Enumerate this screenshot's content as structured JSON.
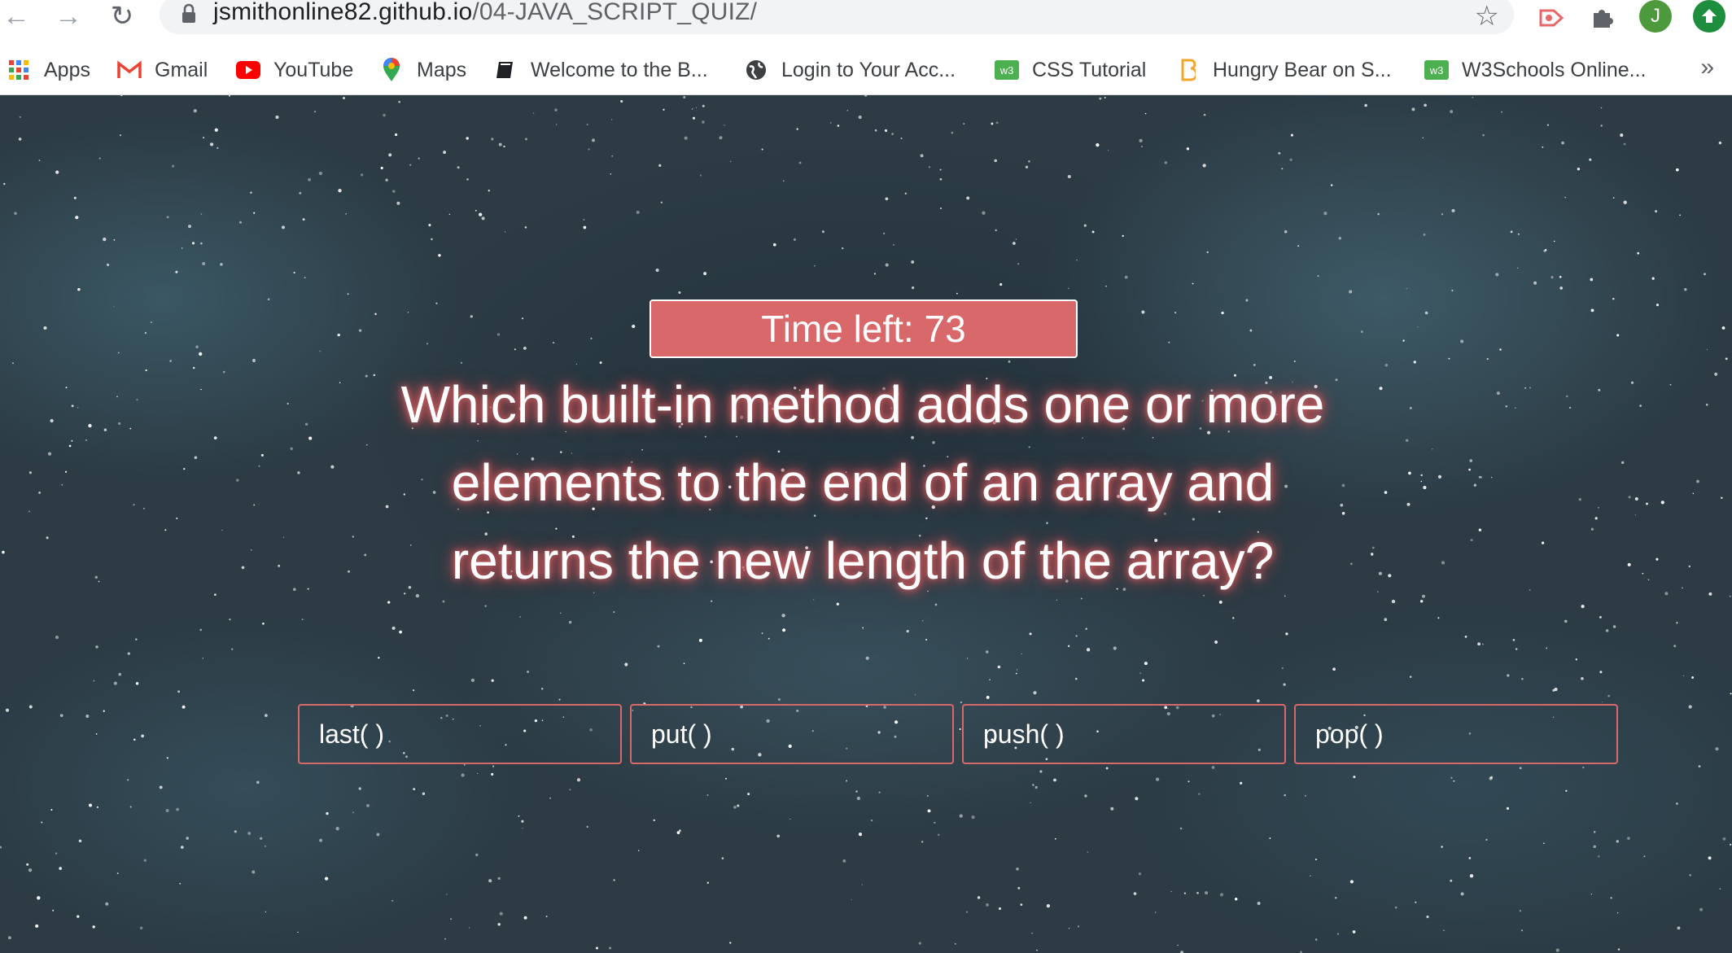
{
  "browser": {
    "url_host": "jsmithonline82.github.io",
    "url_path": "/04-JAVA_SCRIPT_QUIZ/",
    "profile_initial": "J",
    "bookmarks": [
      {
        "label": "Apps",
        "icon": "apps-grid-icon"
      },
      {
        "label": "Gmail",
        "icon": "gmail-icon"
      },
      {
        "label": "YouTube",
        "icon": "youtube-icon"
      },
      {
        "label": "Maps",
        "icon": "maps-pin-icon"
      },
      {
        "label": "Welcome to the B...",
        "icon": "book-icon"
      },
      {
        "label": "Login to Your Acc...",
        "icon": "globe-icon"
      },
      {
        "label": "CSS Tutorial",
        "icon": "w3schools-icon"
      },
      {
        "label": "Hungry Bear on S...",
        "icon": "bear-icon"
      },
      {
        "label": "W3Schools Online...",
        "icon": "w3schools-icon"
      }
    ],
    "more_label": "»"
  },
  "quiz": {
    "timer_label": "Time left: 73",
    "question": "Which built-in method adds one or more elements to the end of an array and returns the new length of the array?",
    "answers": [
      "last( )",
      "put( )",
      "push( )",
      "pop( )"
    ],
    "accent_color": "#d9686b"
  }
}
